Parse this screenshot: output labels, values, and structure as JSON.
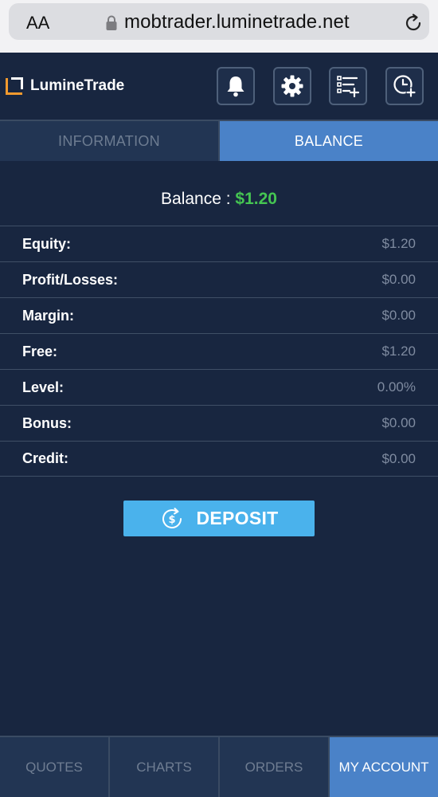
{
  "browser": {
    "text_size_label": "AA",
    "url": "mobtrader.luminetrade.net"
  },
  "header": {
    "brand_name": "LumineTrade",
    "icons": [
      "bell-icon",
      "gear-icon",
      "list-add-icon",
      "clock-add-icon"
    ]
  },
  "tabs": {
    "information": "INFORMATION",
    "balance": "BALANCE",
    "active": "balance"
  },
  "balance": {
    "label": "Balance : ",
    "amount": "$1.20"
  },
  "account_rows": [
    {
      "label": "Equity:",
      "value": "$1.20"
    },
    {
      "label": "Profit/Losses:",
      "value": "$0.00"
    },
    {
      "label": "Margin:",
      "value": "$0.00"
    },
    {
      "label": "Free:",
      "value": "$1.20"
    },
    {
      "label": "Level:",
      "value": "0.00%"
    },
    {
      "label": "Bonus:",
      "value": "$0.00"
    },
    {
      "label": "Credit:",
      "value": "$0.00"
    }
  ],
  "deposit": {
    "label": "DEPOSIT"
  },
  "bottom_nav": [
    {
      "label": "QUOTES",
      "active": false
    },
    {
      "label": "CHARTS",
      "active": false
    },
    {
      "label": "ORDERS",
      "active": false
    },
    {
      "label": "MY ACCOUNT",
      "active": true
    }
  ],
  "colors": {
    "background": "#182640",
    "accent": "#4a82c8",
    "deposit": "#4ab2ec",
    "positive": "#45c552",
    "logo_orange": "#f29a2e"
  }
}
